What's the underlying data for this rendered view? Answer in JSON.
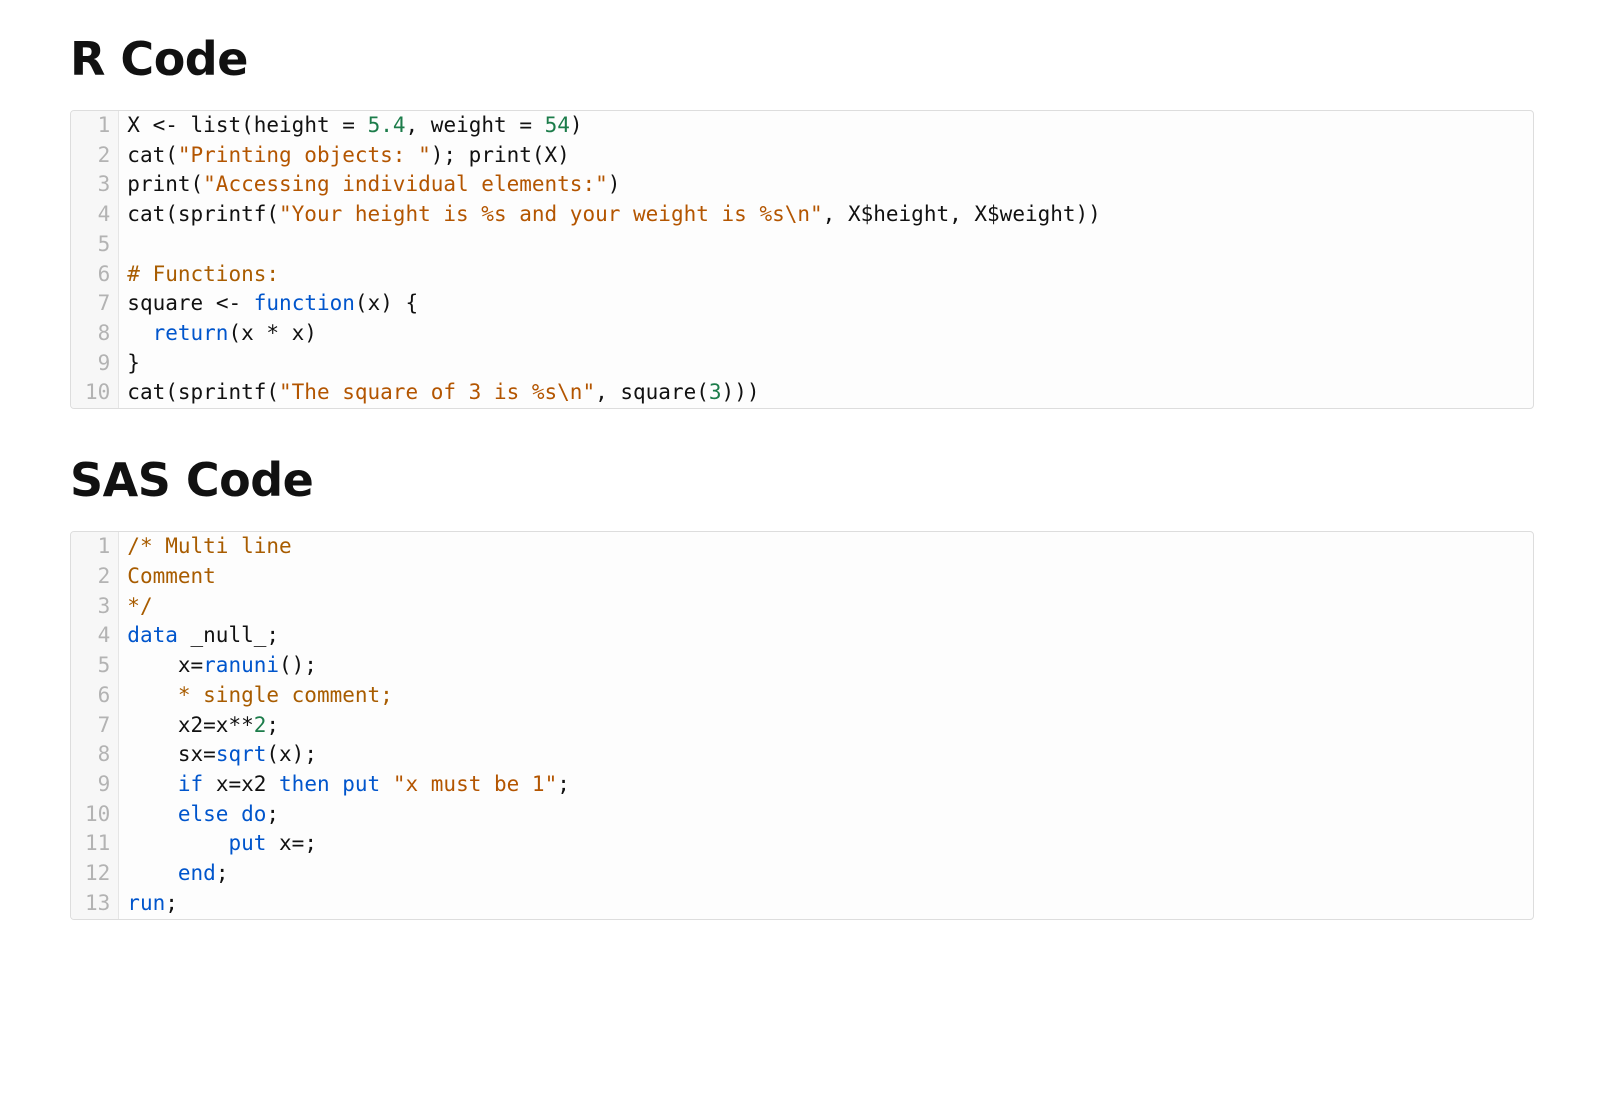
{
  "sections": [
    {
      "id": "r",
      "heading": "R Code",
      "lines": [
        [
          {
            "t": "X ",
            "c": ""
          },
          {
            "t": "<-",
            "c": ""
          },
          {
            "t": " list(height ",
            "c": ""
          },
          {
            "t": "=",
            "c": ""
          },
          {
            "t": " ",
            "c": ""
          },
          {
            "t": "5.4",
            "c": "tok-num"
          },
          {
            "t": ", weight ",
            "c": ""
          },
          {
            "t": "=",
            "c": ""
          },
          {
            "t": " ",
            "c": ""
          },
          {
            "t": "54",
            "c": "tok-num"
          },
          {
            "t": ")",
            "c": ""
          }
        ],
        [
          {
            "t": "cat(",
            "c": ""
          },
          {
            "t": "\"Printing objects: \"",
            "c": "tok-str"
          },
          {
            "t": "); print(X)",
            "c": ""
          }
        ],
        [
          {
            "t": "print(",
            "c": ""
          },
          {
            "t": "\"Accessing individual elements:\"",
            "c": "tok-str"
          },
          {
            "t": ")",
            "c": ""
          }
        ],
        [
          {
            "t": "cat(sprintf(",
            "c": ""
          },
          {
            "t": "\"Your height is %s and your weight is %s\\n\"",
            "c": "tok-str"
          },
          {
            "t": ", X$height, X$weight))",
            "c": ""
          }
        ],
        [
          {
            "t": "",
            "c": ""
          }
        ],
        [
          {
            "t": "# Functions:",
            "c": "tok-cmt"
          }
        ],
        [
          {
            "t": "square ",
            "c": ""
          },
          {
            "t": "<-",
            "c": ""
          },
          {
            "t": " ",
            "c": ""
          },
          {
            "t": "function",
            "c": "tok-kw"
          },
          {
            "t": "(x) {",
            "c": ""
          }
        ],
        [
          {
            "t": "  ",
            "c": ""
          },
          {
            "t": "return",
            "c": "tok-kw"
          },
          {
            "t": "(x * x)",
            "c": ""
          }
        ],
        [
          {
            "t": "}",
            "c": ""
          }
        ],
        [
          {
            "t": "cat(sprintf(",
            "c": ""
          },
          {
            "t": "\"The square of 3 is %s\\n\"",
            "c": "tok-str"
          },
          {
            "t": ", square(",
            "c": ""
          },
          {
            "t": "3",
            "c": "tok-num"
          },
          {
            "t": ")))",
            "c": ""
          }
        ]
      ]
    },
    {
      "id": "sas",
      "heading": "SAS Code",
      "lines": [
        [
          {
            "t": "/* Multi line",
            "c": "tok-cmt"
          }
        ],
        [
          {
            "t": "Comment",
            "c": "tok-cmt"
          }
        ],
        [
          {
            "t": "*/",
            "c": "tok-cmt"
          }
        ],
        [
          {
            "t": "data",
            "c": "tok-kw"
          },
          {
            "t": " _null_;",
            "c": ""
          }
        ],
        [
          {
            "t": "    x=",
            "c": ""
          },
          {
            "t": "ranuni",
            "c": "tok-fn"
          },
          {
            "t": "();",
            "c": ""
          }
        ],
        [
          {
            "t": "    ",
            "c": ""
          },
          {
            "t": "* single comment;",
            "c": "tok-cmt"
          }
        ],
        [
          {
            "t": "    x2=x**",
            "c": ""
          },
          {
            "t": "2",
            "c": "tok-num"
          },
          {
            "t": ";",
            "c": ""
          }
        ],
        [
          {
            "t": "    sx=",
            "c": ""
          },
          {
            "t": "sqrt",
            "c": "tok-fn"
          },
          {
            "t": "(x);",
            "c": ""
          }
        ],
        [
          {
            "t": "    ",
            "c": ""
          },
          {
            "t": "if",
            "c": "tok-kw"
          },
          {
            "t": " x=x2 ",
            "c": ""
          },
          {
            "t": "then",
            "c": "tok-kw"
          },
          {
            "t": " ",
            "c": ""
          },
          {
            "t": "put",
            "c": "tok-kw"
          },
          {
            "t": " ",
            "c": ""
          },
          {
            "t": "\"x must be 1\"",
            "c": "tok-str"
          },
          {
            "t": ";",
            "c": ""
          }
        ],
        [
          {
            "t": "    ",
            "c": ""
          },
          {
            "t": "else",
            "c": "tok-kw"
          },
          {
            "t": " ",
            "c": ""
          },
          {
            "t": "do",
            "c": "tok-kw"
          },
          {
            "t": ";",
            "c": ""
          }
        ],
        [
          {
            "t": "        ",
            "c": ""
          },
          {
            "t": "put",
            "c": "tok-kw"
          },
          {
            "t": " x=;",
            "c": ""
          }
        ],
        [
          {
            "t": "    ",
            "c": ""
          },
          {
            "t": "end",
            "c": "tok-kw"
          },
          {
            "t": ";",
            "c": ""
          }
        ],
        [
          {
            "t": "run",
            "c": "tok-kw"
          },
          {
            "t": ";",
            "c": ""
          }
        ]
      ]
    }
  ]
}
